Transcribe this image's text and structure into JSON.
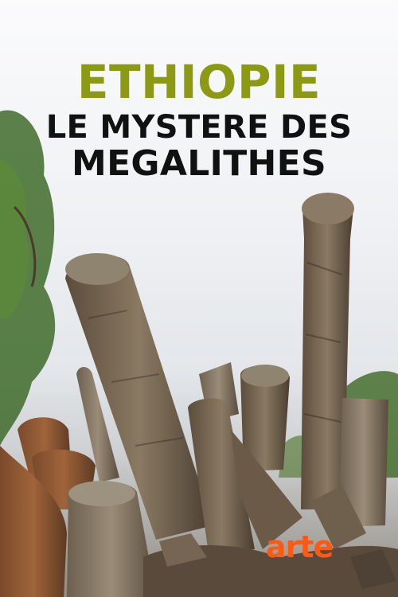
{
  "poster": {
    "title_line1": "ETHIOPIE",
    "title_line2": "LE MYSTERE DES",
    "title_line3": "MEGALITHES",
    "logo": "arte"
  },
  "colors": {
    "title_accent": "#8b9a12",
    "title_main": "#111111",
    "logo": "#ff5a14",
    "sky": "#eef0f3",
    "stone": "#7a6a55",
    "foliage": "#3f6b2a"
  }
}
